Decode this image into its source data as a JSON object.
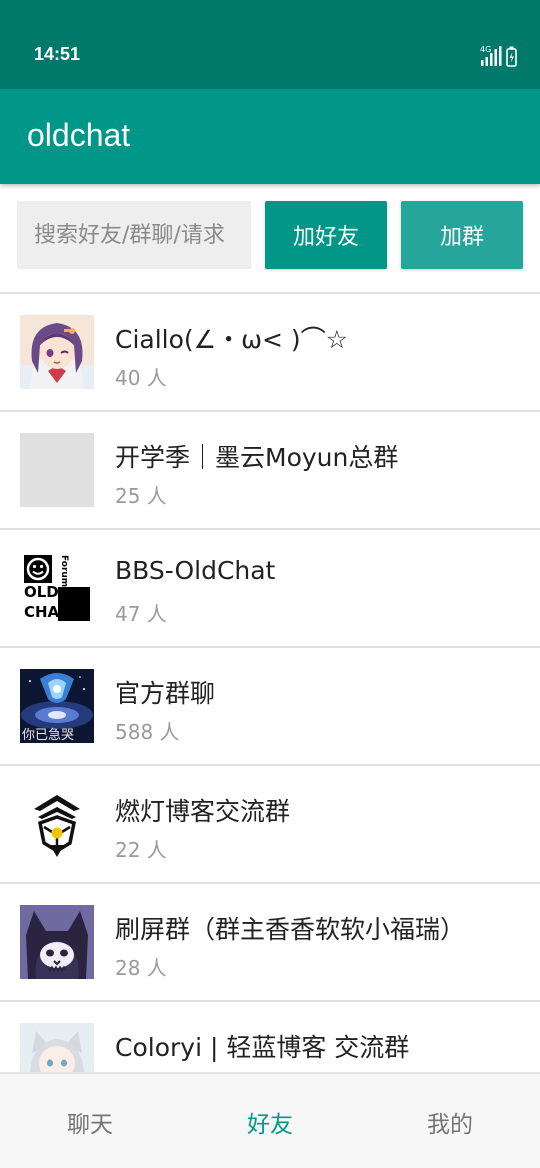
{
  "status_bar": {
    "time": "14:51",
    "network": "4G"
  },
  "app_bar": {
    "title": "oldchat"
  },
  "search": {
    "placeholder": "搜索好友/群聊/请求"
  },
  "actions": {
    "add_friend": "加好友",
    "add_group": "加群"
  },
  "groups": [
    {
      "name": "Ciallo(∠・ω< )⌒☆",
      "count": "40 人",
      "avatar": "anime-girl-avatar"
    },
    {
      "name": "开学季｜墨云Moyun总群",
      "count": "25 人",
      "avatar": "blank-avatar"
    },
    {
      "name": "BBS-OldChat",
      "count": "47 人",
      "avatar": "oldchat-logo-avatar"
    },
    {
      "name": "官方群聊",
      "count": "588 人",
      "avatar": "galaxy-avatar"
    },
    {
      "name": "燃灯博客交流群",
      "count": "22 人",
      "avatar": "emblem-avatar"
    },
    {
      "name": "刷屏群（群主香香软软小福瑞）",
      "count": "28 人",
      "avatar": "furry-avatar"
    },
    {
      "name": "Coloryi | 轻蓝博客 交流群",
      "count": "",
      "avatar": "cat-girl-avatar"
    }
  ],
  "avatar_texts": {
    "oldchat_forum": "Forum",
    "oldchat_old": "OLD",
    "oldchat_chat": "CHAT",
    "galaxy_caption": "你已急哭"
  },
  "bottom_nav": {
    "chat": "聊天",
    "friends": "好友",
    "me": "我的",
    "active": "friends"
  },
  "colors": {
    "primary": "#009688",
    "primary_dark": "#00796B",
    "accent": "#26A69A"
  }
}
